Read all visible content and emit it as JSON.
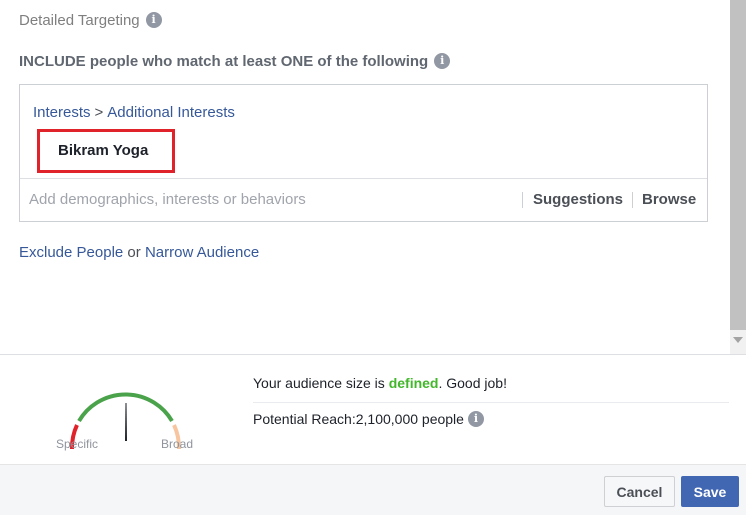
{
  "targeting": {
    "title": "Detailed Targeting",
    "include_label": "INCLUDE people who match at least ONE of the following",
    "breadcrumb": {
      "root": "Interests",
      "separator": ">",
      "child": "Additional Interests"
    },
    "selected_tag": "Bikram Yoga",
    "add_placeholder": "Add demographics, interests or behaviors",
    "suggestions_label": "Suggestions",
    "browse_label": "Browse",
    "exclude_link": "Exclude People",
    "or_text": "or",
    "narrow_link": "Narrow Audience"
  },
  "audience": {
    "size_prefix": "Your audience size is",
    "size_status": "defined",
    "size_suffix": ". Good job!",
    "reach_label": "Potential Reach:",
    "reach_value": "2,100,000 people",
    "gauge": {
      "specific_label": "Specific",
      "broad_label": "Broad",
      "colors": {
        "low": "#e0232b",
        "mid": "#4aa34a",
        "high": "#f7c6a0",
        "needle": "#1d2129"
      }
    }
  },
  "footer": {
    "cancel_label": "Cancel",
    "save_label": "Save"
  },
  "icons": {
    "info": "info-icon"
  },
  "colors": {
    "link": "#365899",
    "highlight": "#e0232b",
    "defined": "#42b72a",
    "save_button": "#4267b2"
  }
}
